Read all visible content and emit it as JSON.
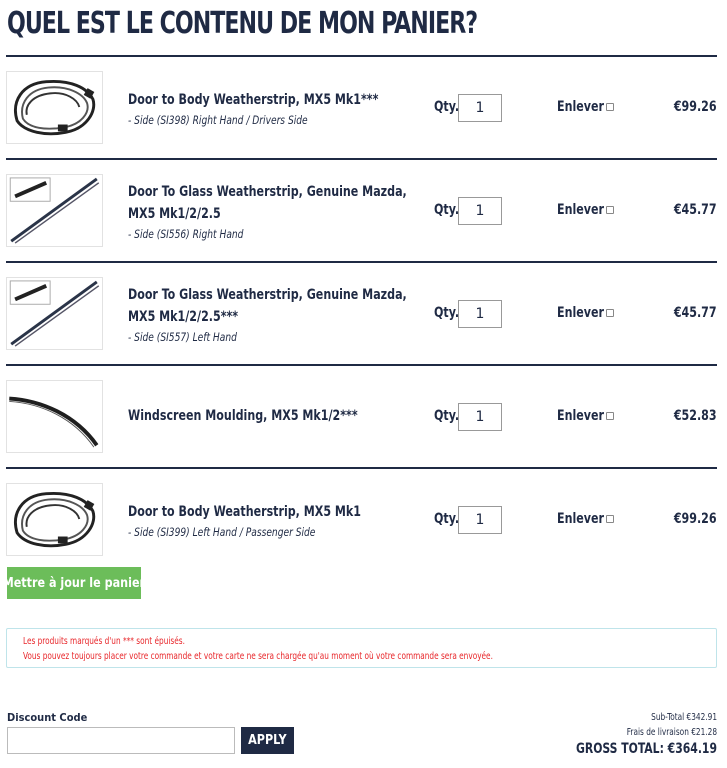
{
  "page": {
    "title": "QUEL EST LE CONTENU DE MON PANIER?"
  },
  "cart": {
    "qty_label": "Qty.",
    "remove_label": "Enlever",
    "items": [
      {
        "title": "Door to Body Weatherstrip, MX5 Mk1***",
        "variant": "- Side (SI398) Right Hand / Drivers Side",
        "qty": "1",
        "price": "€99.26",
        "image": "body-weatherstrip-image"
      },
      {
        "title": "Door To Glass Weatherstrip, Genuine Mazda, MX5 Mk1/2/2.5",
        "variant": "- Side (SI556) Right Hand",
        "qty": "1",
        "price": "€45.77",
        "image": "glass-weatherstrip-image"
      },
      {
        "title": "Door To Glass Weatherstrip, Genuine Mazda, MX5 Mk1/2/2.5***",
        "variant": "- Side (SI557) Left Hand",
        "qty": "1",
        "price": "€45.77",
        "image": "glass-weatherstrip-image"
      },
      {
        "title": "Windscreen Moulding, MX5 Mk1/2***",
        "variant": "",
        "qty": "1",
        "price": "€52.83",
        "image": "windscreen-moulding-image"
      },
      {
        "title": "Door to Body Weatherstrip, MX5 Mk1",
        "variant": "- Side (SI399) Left Hand / Passenger Side",
        "qty": "1",
        "price": "€99.26",
        "image": "body-weatherstrip-image"
      }
    ]
  },
  "update_button": "Mettre à jour le panier",
  "notice": {
    "line1": "Les produits marqués d'un *** sont épuisés.",
    "line2": "Vous pouvez toujours placer votre commande et votre carte ne sera chargée qu'au moment où votre commande sera envoyée."
  },
  "discount": {
    "label": "Discount Code",
    "value": "",
    "apply_label": "APPLY"
  },
  "totals": {
    "subtotal": "Sub-Total €342.91",
    "shipping": "Frais de livraison €21.28",
    "gross": "GROSS TOTAL: €364.19"
  },
  "colors": {
    "navy": "#1f2a44",
    "green": "#6cbd5a",
    "notice_red": "#e8262a",
    "notice_border": "#bfe4ea"
  }
}
